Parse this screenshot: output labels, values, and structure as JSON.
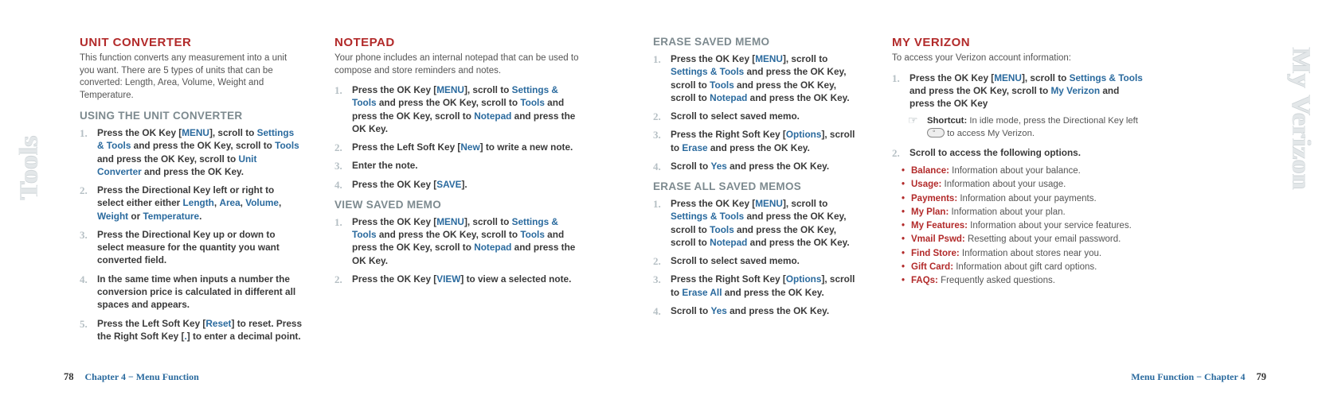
{
  "sideLeft": "Tools",
  "sideRight": "My Verizon",
  "col1": {
    "h2": "UNIT CONVERTER",
    "intro": "This function converts any measurement into a unit you want. There are 5 types of units that can be converted: Length, Area, Volume, Weight and Temperature.",
    "h3": "USING THE UNIT CONVERTER",
    "steps": [
      {
        "pre": "Press the OK Key [",
        "k1": "MENU",
        "mid1": "], scroll to ",
        "k2": "Settings & Tools",
        "mid2": " and press the OK Key, scroll to ",
        "k3": "Tools",
        "mid3": " and press the OK Key, scroll to ",
        "k4": "Unit Converter",
        "post": " and press the OK Key."
      },
      {
        "pre": "Press the Directional Key left or right to select either either ",
        "k1": "Length",
        "mid1": ", ",
        "k2": "Area",
        "mid2": ", ",
        "k3": "Volume",
        "mid3": ", ",
        "k4": "Weight",
        "mid4": " or ",
        "k5": "Temperature",
        "post": "."
      },
      {
        "text": "Press the Directional Key up or down to select measure for the quantity you want converted field."
      },
      {
        "text": "In the same time when inputs a number the conversion price is calculated in different all spaces and appears."
      },
      {
        "pre": "Press the Left Soft Key [",
        "k1": "Reset",
        "mid1": "] to reset. Press the Right Soft Key [",
        "k2": ".",
        "post": "] to enter a decimal point."
      }
    ]
  },
  "col2": {
    "h2": "NOTEPAD",
    "intro": "Your phone includes an internal notepad that can be used to compose and store reminders and notes.",
    "stepsA": [
      {
        "pre": "Press the OK Key [",
        "k1": "MENU",
        "mid1": "], scroll to ",
        "k2": "Settings & Tools",
        "mid2": " and press the OK Key, scroll to ",
        "k3": "Tools",
        "mid3": " and press the OK Key, scroll to ",
        "k4": "Notepad",
        "post": " and press the OK Key."
      },
      {
        "pre": "Press the Left Soft Key [",
        "k1": "New",
        "post": "] to write a new note."
      },
      {
        "text": "Enter the note."
      },
      {
        "pre": "Press the OK Key [",
        "k1": "SAVE",
        "post": "]."
      }
    ],
    "h3b": "VIEW SAVED MEMO",
    "stepsB": [
      {
        "pre": "Press the OK Key [",
        "k1": "MENU",
        "mid1": "], scroll to ",
        "k2": "Settings & Tools",
        "mid2": " and press the OK Key, scroll to ",
        "k3": "Tools",
        "mid3": " and press the OK Key, scroll to ",
        "k4": "Notepad",
        "post": " and press the OK Key."
      },
      {
        "pre": "Press the OK Key [",
        "k1": "VIEW",
        "post": "] to view a selected note."
      }
    ]
  },
  "col3": {
    "h3a": "ERASE SAVED MEMO",
    "stepsA": [
      {
        "pre": "Press the OK Key [",
        "k1": "MENU",
        "mid1": "], scroll to ",
        "k2": "Settings & Tools",
        "mid2": " and press the OK Key, scroll to ",
        "k3": "Tools",
        "mid3": " and press the OK Key, scroll to ",
        "k4": "Notepad",
        "post": " and press the OK Key."
      },
      {
        "text": "Scroll to select saved memo."
      },
      {
        "pre": "Press the Right Soft Key [",
        "k1": "Options",
        "mid1": "], scroll to ",
        "k2": "Erase",
        "post": " and press the OK Key."
      },
      {
        "pre": "Scroll to ",
        "k1": "Yes",
        "post": " and press the OK Key."
      }
    ],
    "h3b": "ERASE ALL SAVED MEMOS",
    "stepsB": [
      {
        "pre": "Press the OK Key [",
        "k1": "MENU",
        "mid1": "], scroll to ",
        "k2": "Settings & Tools",
        "mid2": " and press the OK Key, scroll to ",
        "k3": "Tools",
        "mid3": " and press the OK Key, scroll to ",
        "k4": "Notepad",
        "post": " and press the OK Key."
      },
      {
        "text": "Scroll to select saved memo."
      },
      {
        "pre": "Press the Right Soft Key [",
        "k1": "Options",
        "mid1": "], scroll to ",
        "k2": "Erase All",
        "post": " and press the OK Key."
      },
      {
        "pre": "Scroll to ",
        "k1": "Yes",
        "post": " and press the OK Key."
      }
    ]
  },
  "col4": {
    "h2": "MY VERIZON",
    "intro": "To access your Verizon account information:",
    "steps": [
      {
        "pre": "Press the OK Key [",
        "k1": "MENU",
        "mid1": "], scroll to ",
        "k2": "Settings & Tools",
        "mid2": " and press the OK Key, scroll to ",
        "k3": "My Verizon",
        "post": " and press the OK Key"
      }
    ],
    "shortcut": {
      "label": "Shortcut:",
      "txt1": " In idle mode, press the Directional Key left ",
      "txt2": " to access My Verizon."
    },
    "step2": "Scroll to access the following options.",
    "bullets": [
      {
        "lbl": "Balance:",
        "txt": " Information about your balance."
      },
      {
        "lbl": "Usage:",
        "txt": " Information about your usage."
      },
      {
        "lbl": "Payments:",
        "txt": " Information about your payments."
      },
      {
        "lbl": "My Plan:",
        "txt": " Information about your plan."
      },
      {
        "lbl": "My Features:",
        "txt": " Information about your service features."
      },
      {
        "lbl": "Vmail Pswd:",
        "txt": " Resetting about your email password."
      },
      {
        "lbl": "Find Store:",
        "txt": " Information about stores near you."
      },
      {
        "lbl": "Gift Card:",
        "txt": " Information about gift card options."
      },
      {
        "lbl": "FAQs:",
        "txt": " Frequently asked questions."
      }
    ]
  },
  "footer": {
    "leftNum": "78",
    "leftChap": "Chapter 4 − Menu Function",
    "rightChap": "Menu Function − Chapter 4",
    "rightNum": "79"
  }
}
